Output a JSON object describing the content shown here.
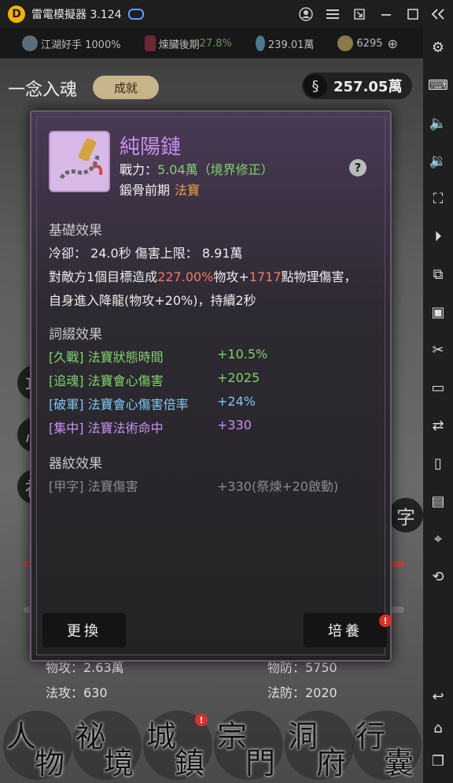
{
  "emulator": {
    "title": "雷電模擬器 3.124"
  },
  "statusbar": {
    "stat1": "江湖好手 1000%",
    "stat2_label": "煉臟後期",
    "stat2_pct": "27.8%",
    "stat3": "239.01萬",
    "stat4": "6295"
  },
  "header": {
    "title": "一念入魂",
    "achievement_button": "成就",
    "currency_amount": "257.05萬"
  },
  "background": {
    "attack_physical": "物攻：2.63萬",
    "defense_physical": "物防：5750",
    "attack_magic": "法攻：630",
    "defense_magic": "法防：2020"
  },
  "modal": {
    "item_name": "純陽鏈",
    "power_label": "戰力：",
    "power_value": "5.04萬（境界修正）",
    "realm": "鍛骨前期",
    "type": "法寶",
    "basic_title": "基礎效果",
    "cooldown": "冷卻：  24.0秒  傷害上限：  8.91萬",
    "desc1_a": "對敵方1個目標造成",
    "desc1_pct": "227.00%",
    "desc1_b": "物攻+",
    "desc1_flat": "1717",
    "desc1_c": "點物理傷害，",
    "desc2": "自身進入降龍(物攻+20%)，持續2秒",
    "affix_title": "詞綴效果",
    "affixes": [
      {
        "name": "[久戰] 法寶狀態時間",
        "value": "+10.5%"
      },
      {
        "name": "[追魂] 法寶會心傷害",
        "value": "+2025"
      },
      {
        "name": "[破軍] 法寶會心傷害倍率",
        "value": "+24%"
      },
      {
        "name": "[集中] 法寶法術命中",
        "value": "+330"
      }
    ],
    "pattern_title": "器紋效果",
    "pattern": {
      "name": "[甲字] 法寶傷害",
      "value": "+330(祭煉+20啟動)"
    },
    "replace_button": "更換",
    "cultivate_button": "培養"
  },
  "nav": [
    {
      "c1": "人",
      "c2": "物"
    },
    {
      "c1": "祕",
      "c2": "境"
    },
    {
      "c1": "城",
      "c2": "鎮"
    },
    {
      "c1": "宗",
      "c2": "門"
    },
    {
      "c1": "洞",
      "c2": "府"
    },
    {
      "c1": "行",
      "c2": "囊"
    }
  ],
  "colors": {
    "item_name": "#c98ff0",
    "green": "#7fd36a",
    "blue": "#7fc9f2",
    "red": "#f07a6a",
    "orange": "#e6a040"
  }
}
